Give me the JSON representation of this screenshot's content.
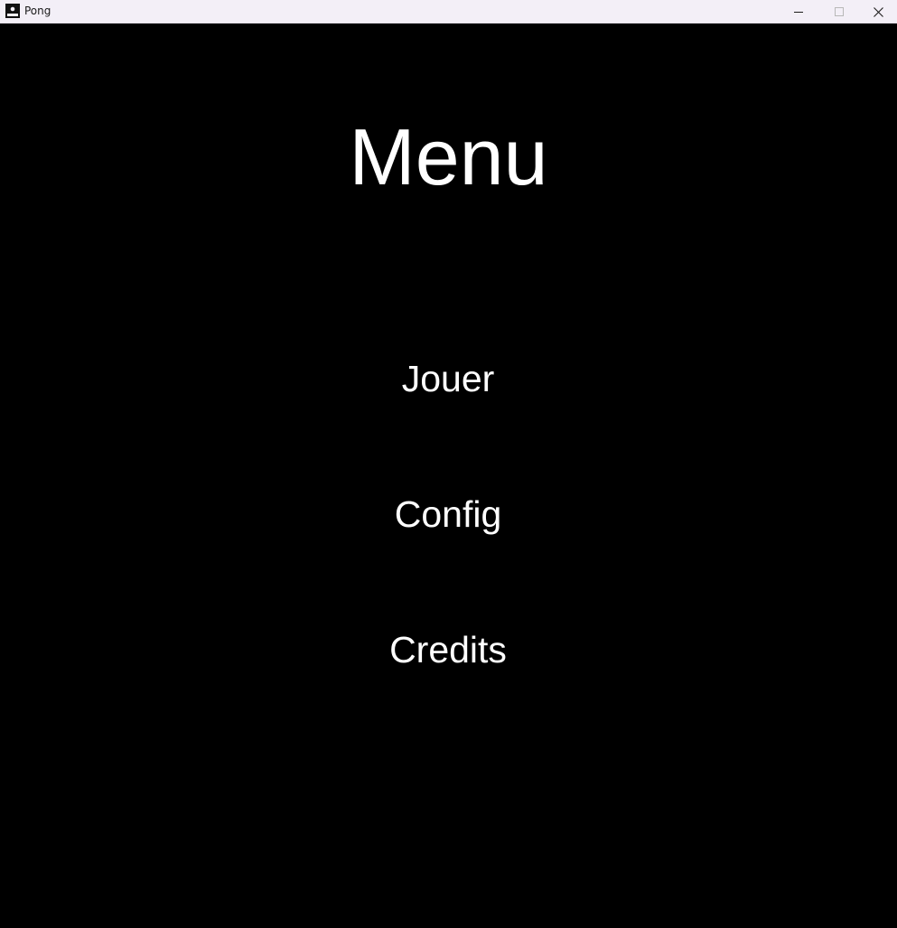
{
  "window": {
    "title": "Pong",
    "app_icon": "pong-app-icon",
    "controls": {
      "minimize": "minimize-icon",
      "maximize": "maximize-icon",
      "close": "close-icon"
    }
  },
  "menu": {
    "title": "Menu",
    "items": [
      {
        "label": "Jouer"
      },
      {
        "label": "Config"
      },
      {
        "label": "Credits"
      }
    ]
  },
  "colors": {
    "background": "#000000",
    "text": "#ffffff",
    "titlebar": "#f3eff7"
  }
}
